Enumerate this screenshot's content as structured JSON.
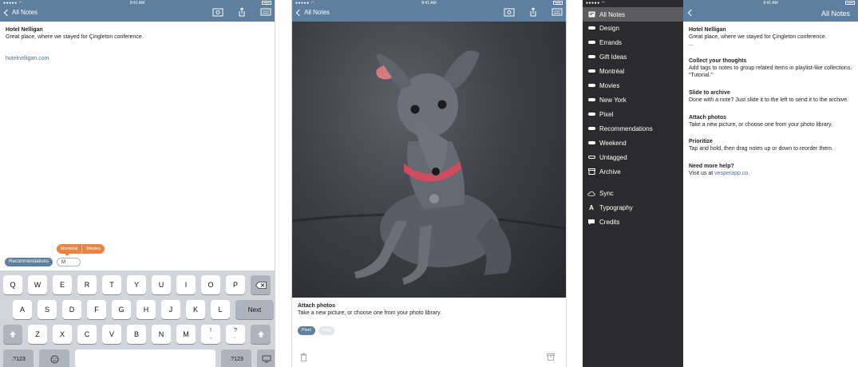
{
  "status": {
    "time": "8:41 AM",
    "signal": "●●●●● ◠",
    "battery": "100%"
  },
  "nav": {
    "back_label": "All Notes"
  },
  "colors": {
    "navbar": "#5e7f9e",
    "tag_popup": "#e98543",
    "sidebar": "#2b2b2d",
    "link": "#4f6f90"
  },
  "screen1": {
    "note_title": "Hotel Nelligan",
    "note_body": "Great place, where we stayed for Çingleton conference.",
    "note_link": "hotelnelligan.com",
    "tag_suggestions": [
      "Montréal",
      "Movies"
    ],
    "existing_tag": "Recommendations",
    "tag_input_value": "M",
    "keyboard": {
      "row1": [
        "Q",
        "W",
        "E",
        "R",
        "T",
        "Y",
        "U",
        "I",
        "O",
        "P"
      ],
      "row2": [
        "A",
        "S",
        "D",
        "F",
        "G",
        "H",
        "J",
        "K",
        "L"
      ],
      "next": "Next",
      "row3": [
        "Z",
        "X",
        "C",
        "V",
        "B",
        "N",
        "M",
        "!\n,",
        "?\n."
      ],
      "num_key": ".?123"
    }
  },
  "screen2": {
    "note_title": "Attach photos",
    "note_body": "Take a new picture, or choose one from your photo library.",
    "tags": [
      "Pixel",
      "Dog"
    ]
  },
  "screen3": {
    "sidebar": {
      "items": [
        "All Notes",
        "Design",
        "Errands",
        "Gift Ideas",
        "Montréal",
        "Movies",
        "New York",
        "Pixel",
        "Recommendations",
        "Weekend",
        "Untagged",
        "Archive"
      ],
      "footer": [
        "Sync",
        "Typography",
        "Credits"
      ]
    },
    "title": "All Notes",
    "notes": [
      {
        "title": "Hotel Nelligan",
        "body": "Great place, where we stayed for Çingleton conference.",
        "extra": "..."
      },
      {
        "title": "Collect your thoughts",
        "body": "Add tags to notes to group related items in playlist-like collections. “Tutorial.”"
      },
      {
        "title": "Slide to archive",
        "body": "Done with a note? Just slide it to the left to send it to the archive."
      },
      {
        "title": "Attach photos",
        "body": "Take a new picture, or choose one from your photo library."
      },
      {
        "title": "Prioritize",
        "body": "Tap and hold, then drag notes up or down to reorder them."
      },
      {
        "title": "Need more help?",
        "body": "Visit us at ",
        "link": "vesperapp.co."
      }
    ]
  }
}
